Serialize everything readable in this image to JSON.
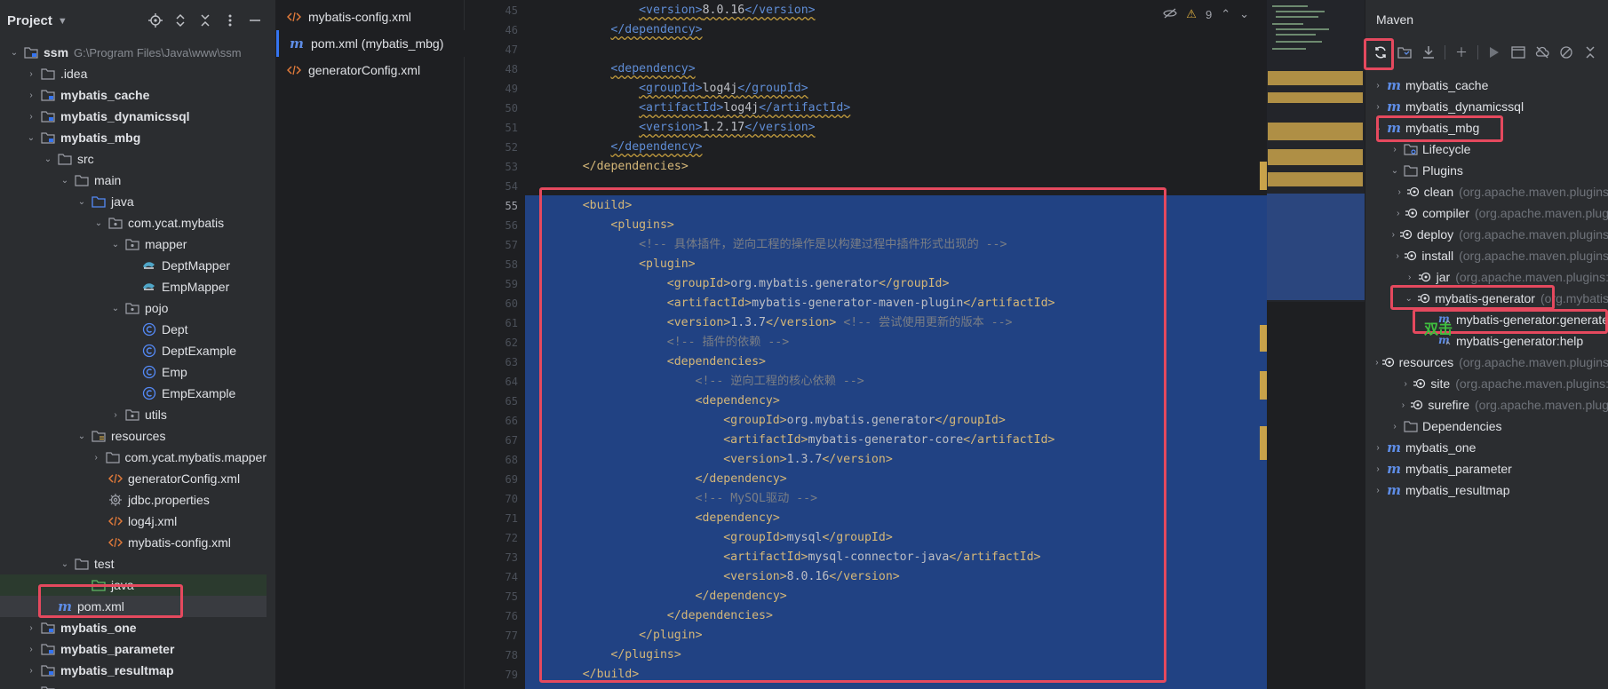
{
  "project_panel": {
    "title": "Project",
    "tree": [
      {
        "label": "ssm",
        "hint": "G:\\Program Files\\Java\\www\\ssm",
        "icon": "module-folder-icon",
        "expanded": true,
        "bold": true
      },
      {
        "label": ".idea",
        "icon": "folder-icon",
        "expanded": false
      },
      {
        "label": "mybatis_cache",
        "icon": "module-folder-icon",
        "expanded": false,
        "bold": true
      },
      {
        "label": "mybatis_dynamicssql",
        "icon": "module-folder-icon",
        "expanded": false,
        "bold": true
      },
      {
        "label": "mybatis_mbg",
        "icon": "module-folder-icon",
        "expanded": true,
        "bold": true
      },
      {
        "label": "src",
        "icon": "folder-icon",
        "expanded": true
      },
      {
        "label": "main",
        "icon": "folder-icon",
        "expanded": true
      },
      {
        "label": "java",
        "icon": "source-folder-icon",
        "expanded": true
      },
      {
        "label": "com.ycat.mybatis",
        "icon": "package-icon",
        "expanded": true
      },
      {
        "label": "mapper",
        "icon": "package-icon",
        "expanded": true
      },
      {
        "label": "DeptMapper",
        "icon": "mapper-icon"
      },
      {
        "label": "EmpMapper",
        "icon": "mapper-icon"
      },
      {
        "label": "pojo",
        "icon": "package-icon",
        "expanded": true
      },
      {
        "label": "Dept",
        "icon": "class-icon"
      },
      {
        "label": "DeptExample",
        "icon": "class-icon"
      },
      {
        "label": "Emp",
        "icon": "class-icon"
      },
      {
        "label": "EmpExample",
        "icon": "class-icon"
      },
      {
        "label": "utils",
        "icon": "package-icon",
        "expanded": false
      },
      {
        "label": "resources",
        "icon": "resources-folder-icon",
        "expanded": true
      },
      {
        "label": "com.ycat.mybatis.mapper",
        "icon": "folder-icon",
        "expanded": false
      },
      {
        "label": "generatorConfig.xml",
        "icon": "xml-icon"
      },
      {
        "label": "jdbc.properties",
        "icon": "gear-icon"
      },
      {
        "label": "log4j.xml",
        "icon": "xml-icon"
      },
      {
        "label": "mybatis-config.xml",
        "icon": "xml-icon"
      },
      {
        "label": "test",
        "icon": "folder-icon",
        "expanded": true
      },
      {
        "label": "java",
        "icon": "test-folder-icon"
      },
      {
        "label": "pom.xml",
        "icon": "maven-icon"
      },
      {
        "label": "mybatis_one",
        "icon": "module-folder-icon",
        "expanded": false,
        "bold": true
      },
      {
        "label": "mybatis_parameter",
        "icon": "module-folder-icon",
        "expanded": false,
        "bold": true
      },
      {
        "label": "mybatis_resultmap",
        "icon": "module-folder-icon",
        "expanded": false,
        "bold": true
      },
      {
        "label": "src",
        "icon": "folder-icon",
        "expanded": false
      }
    ]
  },
  "editor_tabs": [
    {
      "label": "mybatis-config.xml",
      "icon": "xml-icon"
    },
    {
      "label": "pom.xml (mybatis_mbg)",
      "icon": "maven-icon",
      "active": true
    },
    {
      "label": "generatorConfig.xml",
      "icon": "xml-icon"
    }
  ],
  "inspections": {
    "warnings": "9"
  },
  "editor": {
    "line_numbers": [
      "45",
      "46",
      "47",
      "48",
      "49",
      "50",
      "51",
      "52",
      "53",
      "54",
      "55",
      "56",
      "57",
      "58",
      "59",
      "60",
      "61",
      "62",
      "63",
      "64",
      "65",
      "66",
      "67",
      "68",
      "69",
      "70",
      "71",
      "72",
      "73",
      "74",
      "75",
      "76",
      "77",
      "78",
      "79"
    ],
    "current_line": "55",
    "lines": [
      {
        "indent": 3,
        "parts": [
          [
            "tb",
            "<version>"
          ],
          [
            "t",
            "8.0.16"
          ],
          [
            "tb",
            "</version>"
          ]
        ],
        "squig": true
      },
      {
        "indent": 2,
        "parts": [
          [
            "tb",
            "</dependency>"
          ]
        ],
        "squig": true
      },
      {
        "indent": 0,
        "parts": []
      },
      {
        "indent": 2,
        "parts": [
          [
            "tb",
            "<dependency>"
          ]
        ],
        "squig": true
      },
      {
        "indent": 3,
        "parts": [
          [
            "tb",
            "<groupId>"
          ],
          [
            "t",
            "log4j"
          ],
          [
            "tb",
            "</groupId>"
          ]
        ],
        "squig": true
      },
      {
        "indent": 3,
        "parts": [
          [
            "tb",
            "<artifactId>"
          ],
          [
            "t",
            "log4j"
          ],
          [
            "tb",
            "</artifactId>"
          ]
        ],
        "squig": true
      },
      {
        "indent": 3,
        "parts": [
          [
            "tb",
            "<version>"
          ],
          [
            "t",
            "1.2.17"
          ],
          [
            "tb",
            "</version>"
          ]
        ],
        "squig": true
      },
      {
        "indent": 2,
        "parts": [
          [
            "tb",
            "</dependency>"
          ]
        ],
        "squig": true
      },
      {
        "indent": 1,
        "parts": [
          [
            "g",
            "</dependencies>"
          ]
        ]
      },
      {
        "indent": 0,
        "parts": []
      },
      {
        "indent": 1,
        "parts": [
          [
            "g",
            "<build>"
          ]
        ]
      },
      {
        "indent": 2,
        "parts": [
          [
            "g",
            "<plugins>"
          ]
        ]
      },
      {
        "indent": 3,
        "parts": [
          [
            "c",
            "<!-- 具体插件，逆向工程的操作是以构建过程中插件形式出现的 -->"
          ]
        ]
      },
      {
        "indent": 3,
        "parts": [
          [
            "g",
            "<plugin>"
          ]
        ]
      },
      {
        "indent": 4,
        "parts": [
          [
            "g",
            "<groupId>"
          ],
          [
            "t",
            "org.mybatis.generator"
          ],
          [
            "g",
            "</groupId>"
          ]
        ]
      },
      {
        "indent": 4,
        "parts": [
          [
            "g",
            "<artifactId>"
          ],
          [
            "t",
            "mybatis-generator-maven-plugin"
          ],
          [
            "g",
            "</artifactId>"
          ]
        ]
      },
      {
        "indent": 4,
        "parts": [
          [
            "g",
            "<version>"
          ],
          [
            "t",
            "1.3.7"
          ],
          [
            "g",
            "</version>"
          ],
          [
            "c",
            " <!-- 尝试使用更新的版本 -->"
          ]
        ]
      },
      {
        "indent": 4,
        "parts": [
          [
            "c",
            "<!-- 插件的依赖 -->"
          ]
        ]
      },
      {
        "indent": 4,
        "parts": [
          [
            "g",
            "<dependencies>"
          ]
        ]
      },
      {
        "indent": 5,
        "parts": [
          [
            "c",
            "<!-- 逆向工程的核心依赖 -->"
          ]
        ]
      },
      {
        "indent": 5,
        "parts": [
          [
            "g",
            "<dependency>"
          ]
        ]
      },
      {
        "indent": 6,
        "parts": [
          [
            "g",
            "<groupId>"
          ],
          [
            "t",
            "org.mybatis.generator"
          ],
          [
            "g",
            "</groupId>"
          ]
        ]
      },
      {
        "indent": 6,
        "parts": [
          [
            "g",
            "<artifactId>"
          ],
          [
            "t",
            "mybatis-generator-core"
          ],
          [
            "g",
            "</artifactId>"
          ]
        ]
      },
      {
        "indent": 6,
        "parts": [
          [
            "g",
            "<version>"
          ],
          [
            "t",
            "1.3.7"
          ],
          [
            "g",
            "</version>"
          ]
        ]
      },
      {
        "indent": 5,
        "parts": [
          [
            "g",
            "</dependency>"
          ]
        ]
      },
      {
        "indent": 5,
        "parts": [
          [
            "c",
            "<!-- MySQL驱动 -->"
          ]
        ]
      },
      {
        "indent": 5,
        "parts": [
          [
            "g",
            "<dependency>"
          ]
        ]
      },
      {
        "indent": 6,
        "parts": [
          [
            "g",
            "<groupId>"
          ],
          [
            "t",
            "mysql"
          ],
          [
            "g",
            "</groupId>"
          ]
        ]
      },
      {
        "indent": 6,
        "parts": [
          [
            "g",
            "<artifactId>"
          ],
          [
            "t",
            "mysql-connector-java"
          ],
          [
            "g",
            "</artifactId>"
          ]
        ]
      },
      {
        "indent": 6,
        "parts": [
          [
            "g",
            "<version>"
          ],
          [
            "t",
            "8.0.16"
          ],
          [
            "g",
            "</version>"
          ]
        ]
      },
      {
        "indent": 5,
        "parts": [
          [
            "g",
            "</dependency>"
          ]
        ]
      },
      {
        "indent": 4,
        "parts": [
          [
            "g",
            "</dependencies>"
          ]
        ]
      },
      {
        "indent": 3,
        "parts": [
          [
            "g",
            "</plugin>"
          ]
        ]
      },
      {
        "indent": 2,
        "parts": [
          [
            "g",
            "</plugins>"
          ]
        ]
      },
      {
        "indent": 1,
        "parts": [
          [
            "g",
            "</build>"
          ]
        ]
      }
    ]
  },
  "maven_panel": {
    "title": "Maven",
    "annotation": "双击",
    "tree": [
      {
        "label": "mybatis_cache",
        "icon": "maven-icon",
        "expanded": false
      },
      {
        "label": "mybatis_dynamicssql",
        "icon": "maven-icon",
        "expanded": false
      },
      {
        "label": "mybatis_mbg",
        "icon": "maven-icon",
        "expanded": true
      },
      {
        "label": "Lifecycle",
        "icon": "lifecycle-folder-icon",
        "expanded": false
      },
      {
        "label": "Plugins",
        "icon": "plugins-folder-icon",
        "expanded": true
      },
      {
        "label": "clean",
        "hint": "(org.apache.maven.plugins",
        "icon": "plugin-icon",
        "expanded": false
      },
      {
        "label": "compiler",
        "hint": "(org.apache.maven.plug",
        "icon": "plugin-icon",
        "expanded": false
      },
      {
        "label": "deploy",
        "hint": "(org.apache.maven.plugins",
        "icon": "plugin-icon",
        "expanded": false
      },
      {
        "label": "install",
        "hint": "(org.apache.maven.plugins",
        "icon": "plugin-icon",
        "expanded": false
      },
      {
        "label": "jar",
        "hint": "(org.apache.maven.plugins:",
        "icon": "plugin-icon",
        "expanded": false
      },
      {
        "label": "mybatis-generator",
        "hint": "(org.mybatis",
        "icon": "plugin-icon",
        "expanded": true
      },
      {
        "label": "mybatis-generator:generate",
        "icon": "goal-icon"
      },
      {
        "label": "mybatis-generator:help",
        "icon": "goal-icon"
      },
      {
        "label": "resources",
        "hint": "(org.apache.maven.plugins",
        "icon": "plugin-icon",
        "expanded": false
      },
      {
        "label": "site",
        "hint": "(org.apache.maven.plugins:",
        "icon": "plugin-icon",
        "expanded": false
      },
      {
        "label": "surefire",
        "hint": "(org.apache.maven.plug",
        "icon": "plugin-icon",
        "expanded": false
      },
      {
        "label": "Dependencies",
        "icon": "dependencies-folder-icon",
        "expanded": false
      },
      {
        "label": "mybatis_one",
        "icon": "maven-icon",
        "expanded": false
      },
      {
        "label": "mybatis_parameter",
        "icon": "maven-icon",
        "expanded": false
      },
      {
        "label": "mybatis_resultmap",
        "icon": "maven-icon",
        "expanded": false
      }
    ]
  },
  "colors": {
    "accent": "#3574f0",
    "highlight_box": "#e5495e",
    "selection": "#214283",
    "annotation": "#3fbf3f"
  }
}
